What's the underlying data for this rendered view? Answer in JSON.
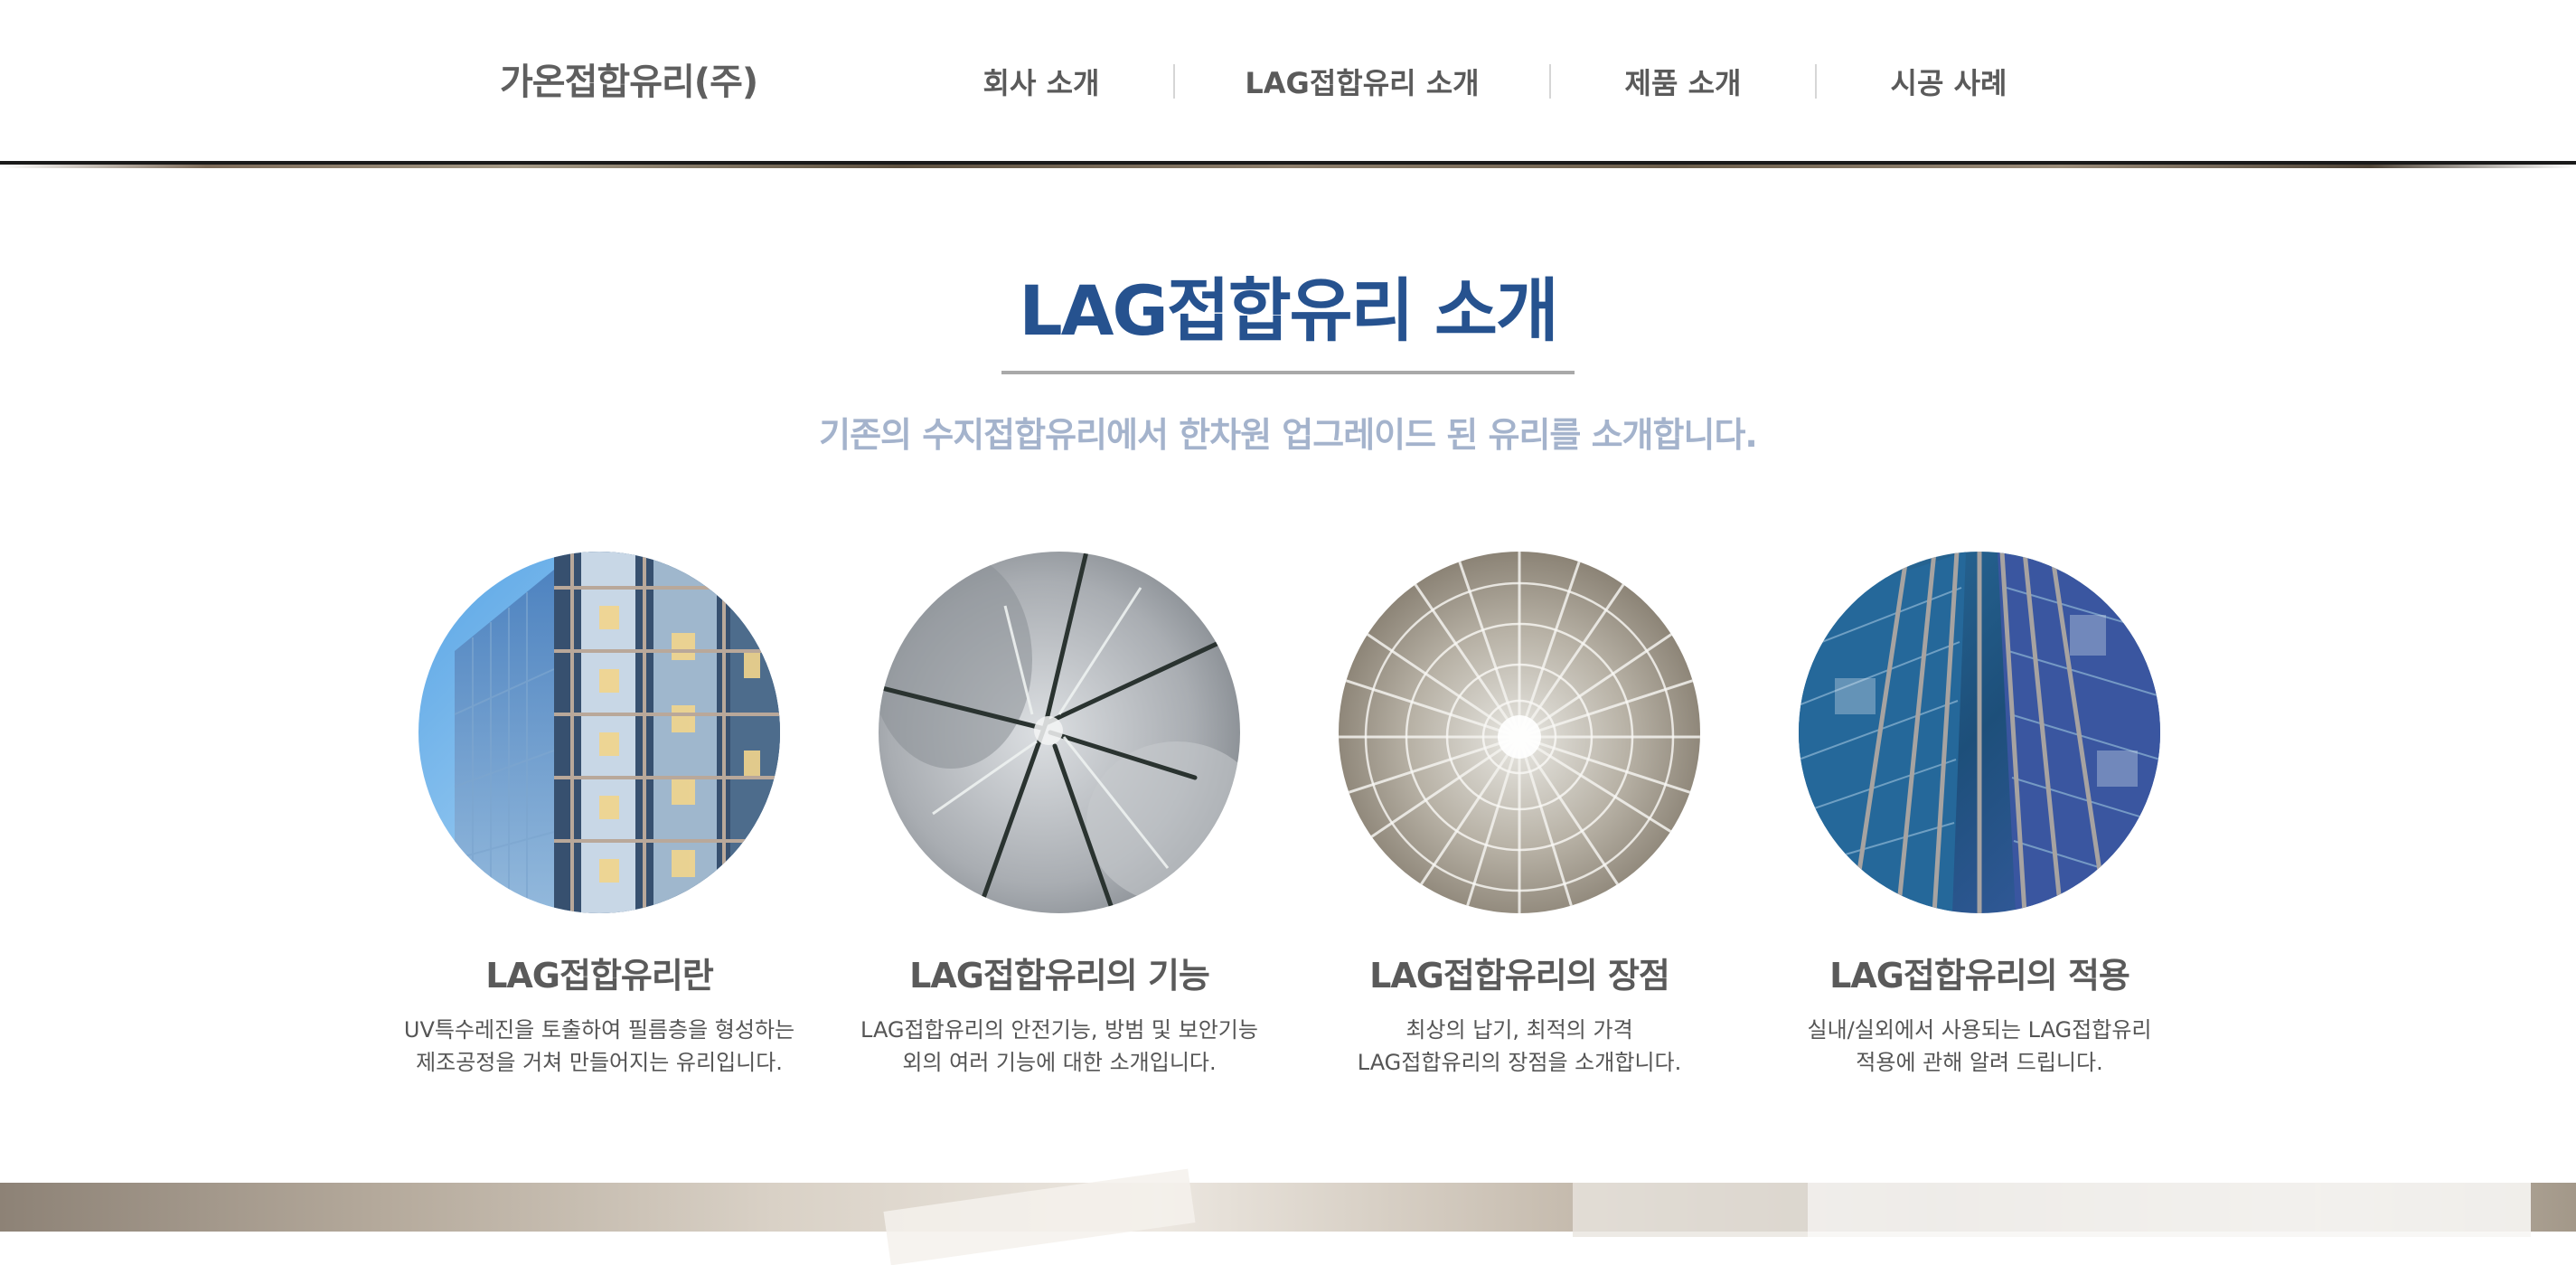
{
  "header": {
    "logo": "가온접합유리(주)",
    "nav": [
      {
        "label": "회사 소개"
      },
      {
        "label": "LAG접합유리 소개"
      },
      {
        "label": "제품 소개"
      },
      {
        "label": "시공 사례"
      }
    ]
  },
  "intro": {
    "title": "LAG접합유리 소개",
    "subtitle": "기존의 수지접합유리에서 한차원 업그레이드 된 유리를 소개합니다."
  },
  "features": [
    {
      "image": "glass-building-photo",
      "title": "LAG접합유리란",
      "desc_line1": "UV특수레진을 토출하여 필름층을 형성하는",
      "desc_line2": "제조공정을 거쳐 만들어지는 유리입니다."
    },
    {
      "image": "cracked-glass-photo",
      "title": "LAG접합유리의 기능",
      "desc_line1": "LAG접합유리의 안전기능, 방범 및 보안기능",
      "desc_line2": "외의 여러 기능에 대한 소개입니다."
    },
    {
      "image": "shattered-glass-photo",
      "title": "LAG접합유리의 장점",
      "desc_line1": "최상의 납기, 최적의 가격",
      "desc_line2": "LAG접합유리의 장점을 소개합니다."
    },
    {
      "image": "skyscraper-facade-photo",
      "title": "LAG접합유리의 적용",
      "desc_line1": "실내/실외에서 사용되는 LAG접합유리",
      "desc_line2": "적용에 관해 알려 드립니다."
    }
  ],
  "colors": {
    "title_blue": "#26528f",
    "subtitle_blue": "#a4b3cc",
    "text_gray": "#555555",
    "header_line": "#1a1a1a"
  }
}
